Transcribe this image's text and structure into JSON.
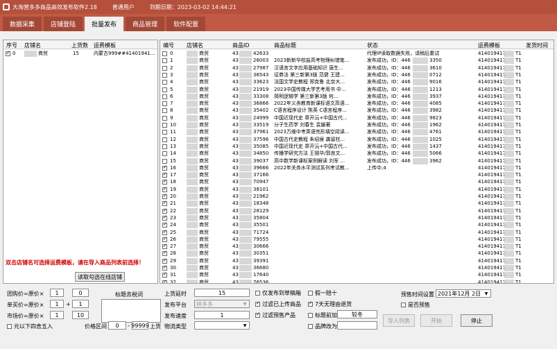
{
  "titlebar": {
    "app": "大淘营多多商品高效发布软件2.18",
    "user": "普通用户",
    "expiry": "到期日期：2023-03-02 14:44:21"
  },
  "tabs": [
    "数据采集",
    "店铺登陆",
    "批量发布",
    "商品管理",
    "软件配置"
  ],
  "active_tab": 2,
  "store_table": {
    "headers": [
      "序号",
      "店铺名",
      "上货数",
      "运费模板"
    ],
    "rows": [
      {
        "no": "0",
        "name": "商贸",
        "count": "15",
        "template": "内蒙古999##41401941..."
      }
    ]
  },
  "red_tip": "双击店铺名可选择运费模板，请在导入商品列表前选择！",
  "login_button": "读取勾选在线店铺",
  "goods_table": {
    "headers": [
      "编号",
      "店铺名",
      "商品ID",
      "商品标题",
      "状态",
      "运费模板",
      "发货时间"
    ],
    "rows": [
      {
        "no": "0",
        "chk": false,
        "store": "商贸",
        "id": "43",
        "idtail": "42633",
        "title": "",
        "status": "代理IP读取数据失败，请稍后重试",
        "tpl": "4140194177",
        "ship": "T1"
      },
      {
        "no": "1",
        "chk": false,
        "store": "商贸",
        "id": "43",
        "idtail": "26003",
        "title": "2023新新华校盐高考物理纠错笔...",
        "status": "发布成功，ID：446",
        "st2": "3350",
        "tpl": "4140194177",
        "ship": "T1"
      },
      {
        "no": "2",
        "chk": false,
        "store": "商贸",
        "id": "43",
        "idtail": "27987",
        "title": "汉语言文字应用基础知识 唐生...",
        "status": "发布成功，ID：446",
        "st2": "3610",
        "tpl": "4140194177",
        "ship": "T1"
      },
      {
        "no": "3",
        "chk": false,
        "store": "商贸",
        "id": "43",
        "idtail": "36543",
        "title": "证券法 第三新第3版 范健 王建...",
        "status": "发布成功，ID：446",
        "st2": "0712",
        "tpl": "4140194177",
        "ship": "T1"
      },
      {
        "no": "4",
        "chk": false,
        "store": "商贸",
        "id": "43",
        "idtail": "33623",
        "title": "法国文学史教程 郑克鲁 北京大...",
        "status": "发布成功，ID：446",
        "st2": "9016",
        "tpl": "4140194177",
        "ship": "T1"
      },
      {
        "no": "5",
        "chk": false,
        "store": "商贸",
        "id": "43",
        "idtail": "21919",
        "title": "2023中国传媒大学艺考用书 中...",
        "status": "发布成功，ID：446",
        "st2": "1213",
        "tpl": "4140194177",
        "ship": "T1"
      },
      {
        "no": "6",
        "chk": false,
        "store": "商贸",
        "id": "43",
        "idtail": "33308",
        "title": "简明逻辑学 第三新第3版 何...",
        "status": "发布成功，ID：446",
        "st2": "3937",
        "tpl": "4140194177",
        "ship": "T1"
      },
      {
        "no": "7",
        "chk": false,
        "store": "商贸",
        "id": "43",
        "idtail": "36866",
        "title": "2022年义务教育新课标语文高语...",
        "status": "发布成功，ID：446",
        "st2": "4085",
        "tpl": "4140194177",
        "ship": "T1"
      },
      {
        "no": "8",
        "chk": false,
        "store": "商贸",
        "id": "43",
        "idtail": "35402",
        "title": "C语言程序设计 陈英 C语言程序...",
        "status": "发布成功，ID：446",
        "st2": "3982",
        "tpl": "4140194177",
        "ship": "T1"
      },
      {
        "no": "9",
        "chk": false,
        "store": "商贸",
        "id": "43",
        "idtail": "24999",
        "title": "中国近现代史 章开沅+中国古代...",
        "status": "发布成功，ID：446",
        "st2": "9823",
        "tpl": "4140194177",
        "ship": "T1"
      },
      {
        "no": "10",
        "chk": false,
        "store": "商贸",
        "id": "43",
        "idtail": "33519",
        "title": "分子生药学 刘春生 袁媛著",
        "status": "发布成功，ID：446",
        "st2": "1962",
        "tpl": "4140194177",
        "ship": "T1"
      },
      {
        "no": "11",
        "chk": false,
        "store": "商贸",
        "id": "43",
        "idtail": "37961",
        "title": "2023万维中考英语完形填空阅读...",
        "status": "发布成功，ID：446",
        "st2": "4761",
        "tpl": "4140194177",
        "ship": "T1"
      },
      {
        "no": "12",
        "chk": false,
        "store": "商贸",
        "id": "43",
        "idtail": "37596",
        "title": "中国古代史教程 朱绍侯 龚留柱...",
        "status": "发布成功，ID：446",
        "st2": "1025",
        "tpl": "4140194177",
        "ship": "T1"
      },
      {
        "no": "13",
        "chk": false,
        "store": "商贸",
        "id": "43",
        "idtail": "35085",
        "title": "中国近现代史 章开沅+中国古代...",
        "status": "发布成功，ID：446",
        "st2": "1437",
        "tpl": "4140194177",
        "ship": "T1"
      },
      {
        "no": "14",
        "chk": false,
        "store": "商贸",
        "id": "43",
        "idtail": "34850",
        "title": "传播学研究方法 王锡华/郭良文...",
        "status": "发布成功，ID：446",
        "st2": "5066",
        "tpl": "4140194177",
        "ship": "T1"
      },
      {
        "no": "15",
        "chk": false,
        "store": "商贸",
        "id": "43",
        "idtail": "39037",
        "title": "高中数学新课标案例解读 刘军 ...",
        "status": "发布成功，ID：446",
        "st2": "3962",
        "tpl": "4140194177",
        "ship": "T1"
      },
      {
        "no": "16",
        "chk": true,
        "store": "商贸",
        "id": "43",
        "idtail": "39666",
        "title": "2022年关务水平测试系列考试教...",
        "status": "上传中,4",
        "tpl": "4140194177",
        "ship": "T1"
      },
      {
        "no": "17",
        "chk": true,
        "store": "商贸",
        "id": "43",
        "idtail": "37166",
        "title": "",
        "status": "",
        "tpl": "4140194177",
        "ship": "T1"
      },
      {
        "no": "18",
        "chk": true,
        "store": "商贸",
        "id": "43",
        "idtail": "70947",
        "title": "",
        "status": "",
        "tpl": "4140194177",
        "ship": "T1"
      },
      {
        "no": "19",
        "chk": true,
        "store": "商贸",
        "id": "43",
        "idtail": "38101",
        "title": "",
        "status": "",
        "tpl": "4140194177",
        "ship": "T1"
      },
      {
        "no": "20",
        "chk": true,
        "store": "商贸",
        "id": "43",
        "idtail": "21962",
        "title": "",
        "status": "",
        "tpl": "4140194177",
        "ship": "T1"
      },
      {
        "no": "21",
        "chk": true,
        "store": "商贸",
        "id": "43",
        "idtail": "18348",
        "title": "",
        "status": "",
        "tpl": "4140194177",
        "ship": "T1"
      },
      {
        "no": "22",
        "chk": true,
        "store": "商贸",
        "id": "43",
        "idtail": "28129",
        "title": "",
        "status": "",
        "tpl": "4140194177",
        "ship": "T1"
      },
      {
        "no": "23",
        "chk": true,
        "store": "商贸",
        "id": "43",
        "idtail": "35804",
        "title": "",
        "status": "",
        "tpl": "4140194177",
        "ship": "T1"
      },
      {
        "no": "24",
        "chk": true,
        "store": "商贸",
        "id": "43",
        "idtail": "35501",
        "title": "",
        "status": "",
        "tpl": "4140194177",
        "ship": "T1"
      },
      {
        "no": "25",
        "chk": true,
        "store": "商贸",
        "id": "43",
        "idtail": "71724",
        "title": "",
        "status": "",
        "tpl": "4140194177",
        "ship": "T1"
      },
      {
        "no": "26",
        "chk": true,
        "store": "商贸",
        "id": "43",
        "idtail": "79555",
        "title": "",
        "status": "",
        "tpl": "4140194177",
        "ship": "T1"
      },
      {
        "no": "27",
        "chk": true,
        "store": "商贸",
        "id": "43",
        "idtail": "30666",
        "title": "",
        "status": "",
        "tpl": "4140194177",
        "ship": "T1"
      },
      {
        "no": "28",
        "chk": true,
        "store": "商贸",
        "id": "43",
        "idtail": "30351",
        "title": "",
        "status": "",
        "tpl": "4140194177",
        "ship": "T1"
      },
      {
        "no": "29",
        "chk": true,
        "store": "商贸",
        "id": "43",
        "idtail": "39391",
        "title": "",
        "status": "",
        "tpl": "4140194177",
        "ship": "T1"
      },
      {
        "no": "30",
        "chk": true,
        "store": "商贸",
        "id": "43",
        "idtail": "36680",
        "title": "",
        "status": "",
        "tpl": "4140194177",
        "ship": "T1"
      },
      {
        "no": "31",
        "chk": true,
        "store": "商贸",
        "id": "43",
        "idtail": "17640",
        "title": "",
        "status": "",
        "tpl": "4140194177",
        "ship": "T1"
      },
      {
        "no": "32",
        "chk": true,
        "store": "商贸",
        "id": "43",
        "idtail": "76536",
        "title": "",
        "status": "",
        "tpl": "4140194177",
        "ship": "T1"
      }
    ]
  },
  "settings": {
    "group_price_label": "团购价=原价×",
    "group_mul": "1",
    "group_add": "0",
    "single_price_label": "单买价=原价×",
    "single_mul": "1",
    "single_plus": "+",
    "single_add": "1",
    "market_price_label": "市场价=原价×",
    "market_mul": "1",
    "market_add": "10",
    "round_label": "元以下四舍五入",
    "title_rule_label": "标题去税词",
    "price_range_label": "价格区间",
    "price_min": "0",
    "price_sep": "-",
    "price_max": "99999",
    "price_unit": "上货",
    "delay_label": "上货延时",
    "delay_value": "15",
    "platform_label": "发布平台",
    "platform_value": "拼多多",
    "speed_label": "发布速度",
    "speed_value": "1",
    "logistics_label": "物流类型",
    "logistics_value": "",
    "only_publish": "仅发布到草稿箱",
    "buy_one": "假一赔十",
    "filter_uploaded": "过滤已上传商品",
    "seven_days": "7天无理由退货",
    "filter_presale": "过滤预售产品",
    "title_prefix": "标题前加",
    "title_prefix_value": "较冬",
    "brand_to": "品牌改为",
    "presale_label": "预售时间设置",
    "presale_date": "2021年12月  2日",
    "is_brand": "是否预售",
    "import_button": "导入列表",
    "start_button": "开始",
    "stop_button": "停止"
  }
}
